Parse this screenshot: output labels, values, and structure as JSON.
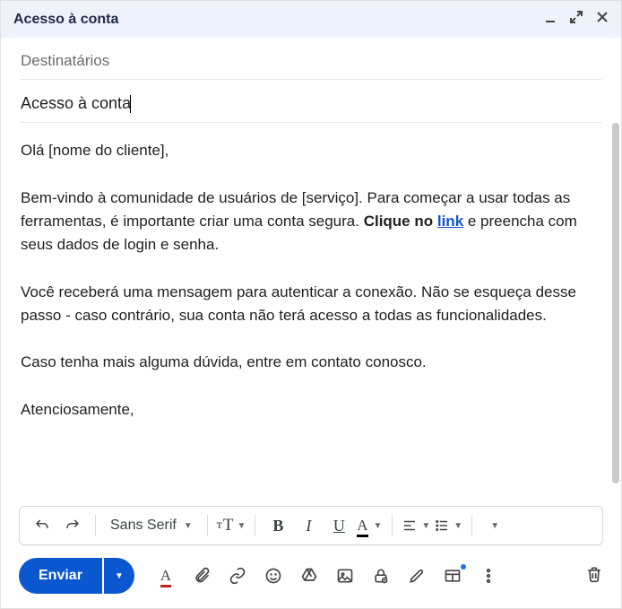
{
  "header": {
    "title": "Acesso à conta"
  },
  "fields": {
    "recipients_placeholder": "Destinatários",
    "subject_value": "Acesso à conta"
  },
  "body": {
    "greeting": "Olá [nome do cliente],",
    "p1_pre": "Bem-vindo à comunidade de usuários de [serviço]. Para começar a usar todas as ferramentas, é importante criar uma conta segura. ",
    "p1_bold": "Clique no ",
    "p1_link": "link",
    "p1_post": " e preencha com seus dados de login e senha.",
    "p2": "Você receberá uma mensagem para autenticar a conexão. Não se esqueça desse passo - caso contrário, sua conta não terá acesso a todas as funcionalidades.",
    "p3": "Caso tenha mais alguma dúvida, entre em contato conosco.",
    "signoff": "Atenciosamente,"
  },
  "toolbar": {
    "font_label": "Sans Serif",
    "bold": "B",
    "italic": "I",
    "underline": "U",
    "color_glyph": "A"
  },
  "actions": {
    "send_label": "Enviar"
  }
}
